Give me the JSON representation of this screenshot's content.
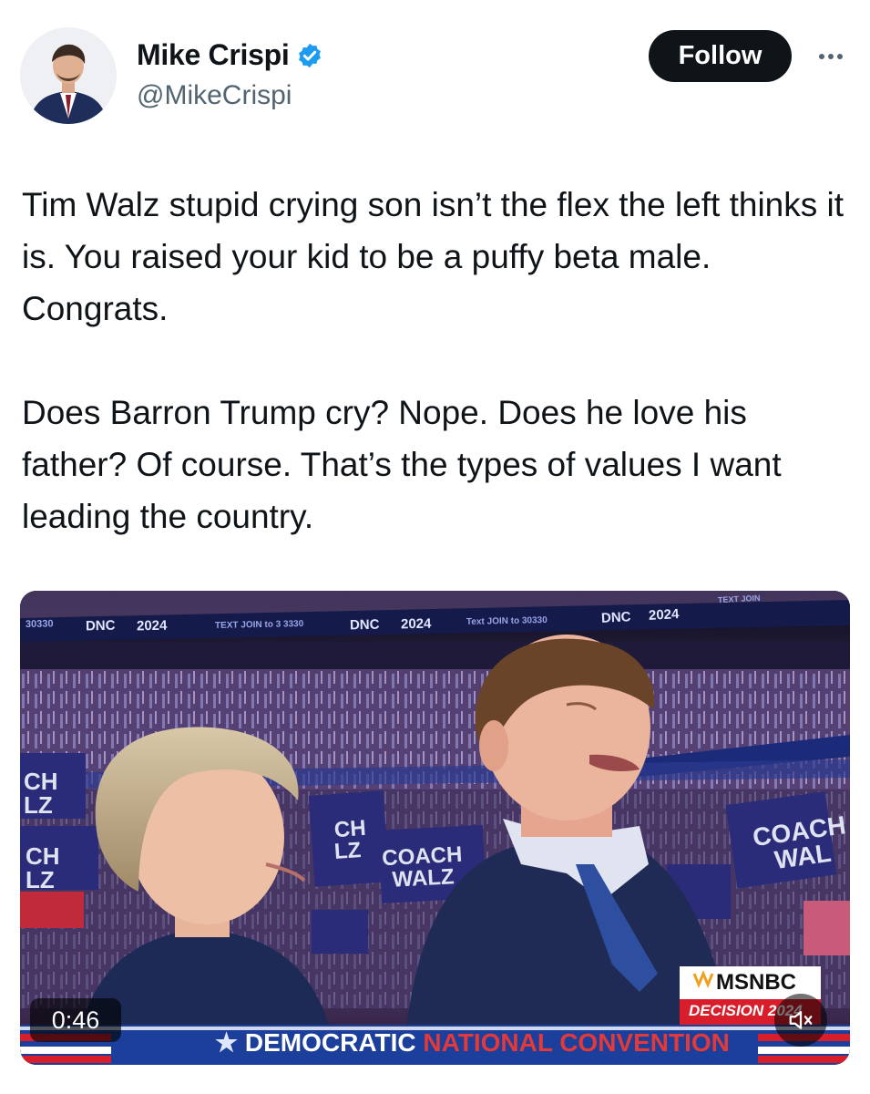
{
  "author": {
    "display_name": "Mike Crispi",
    "handle": "@MikeCrispi",
    "verified_icon": "verified-badge-icon",
    "avatar_icon": "profile-photo"
  },
  "actions": {
    "follow_label": "Follow",
    "more_icon": "more-horizontal-icon"
  },
  "tweet": {
    "paragraphs": [
      "Tim Walz stupid crying son isn’t the flex the left thinks it is. You raised your kid to be a puffy beta male. Congrats.",
      "Does Barron Trump cry? Nope. Does he love his father? Of course. That’s the types of values I want leading the country."
    ]
  },
  "video": {
    "duration": "0:46",
    "mute_icon": "volume-muted-icon",
    "ribbon": [
      "30330",
      "DNC",
      "2024",
      "TEXT JOIN to 3 3330",
      "DNC",
      "2024",
      "Text JOIN to 30330",
      "DNC",
      "2024",
      "TEXT JOIN"
    ],
    "signs": {
      "sign_1": [
        "COACH",
        "WALZ"
      ],
      "sign_2": [
        "COACH",
        "WAL"
      ],
      "sign_left_1": "CH",
      "sign_left_2": "LZ",
      "sign_left_3": "CH",
      "sign_left_4": "LZ",
      "sign_mid_1": "CH",
      "sign_mid_2": "LZ"
    },
    "network_logo": "MSNBC",
    "network_tag": "DECISION 2024",
    "banner_part1": "DEMOCRATIC",
    "banner_part2": "NATIONAL CONVENTION",
    "colors": {
      "banner_blue": "#1b3f9a",
      "banner_red": "#d81e2a",
      "sign_navy": "#2a2c7a",
      "crowd_purple": "#4b3a7a"
    }
  }
}
